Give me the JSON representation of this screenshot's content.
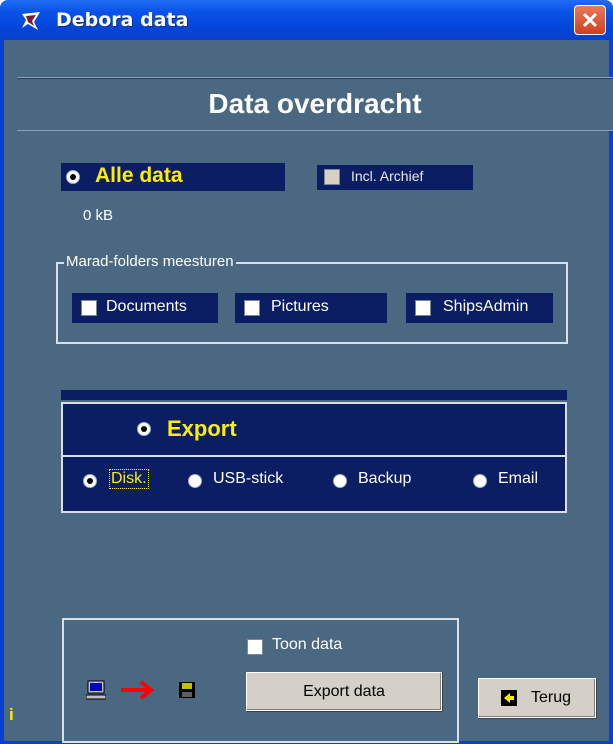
{
  "window": {
    "title": "Debora data",
    "close_glyph": "✕"
  },
  "header": {
    "title": "Data overdracht"
  },
  "all_data": {
    "label": "Alle data",
    "selected": true,
    "size": "0 kB"
  },
  "archive": {
    "label": "Incl. Archief",
    "checked": false
  },
  "marad_folders": {
    "legend": "Marad-folders meesturen",
    "items": [
      {
        "label": "Documents",
        "checked": false
      },
      {
        "label": "Pictures",
        "checked": false
      },
      {
        "label": "ShipsAdmin",
        "checked": false
      }
    ]
  },
  "export": {
    "label": "Export",
    "selected": true,
    "targets": [
      {
        "label": "Disk.",
        "selected": true
      },
      {
        "label": "USB-stick",
        "selected": false
      },
      {
        "label": "Backup",
        "selected": false
      },
      {
        "label": "Email",
        "selected": false
      }
    ]
  },
  "bottom": {
    "show_data_label": "Toon data",
    "export_button": "Export data",
    "back_button": "Terug",
    "info_glyph": "i"
  },
  "icons": [
    "app-icon",
    "computer-icon",
    "arrow-right-icon",
    "floppy-disk-icon",
    "arrow-left-icon"
  ],
  "colors": {
    "title_bar": "#0a52e6",
    "client_bg": "#4b6882",
    "navy_panel": "#0b1e63",
    "highlight": "#ffee00"
  }
}
